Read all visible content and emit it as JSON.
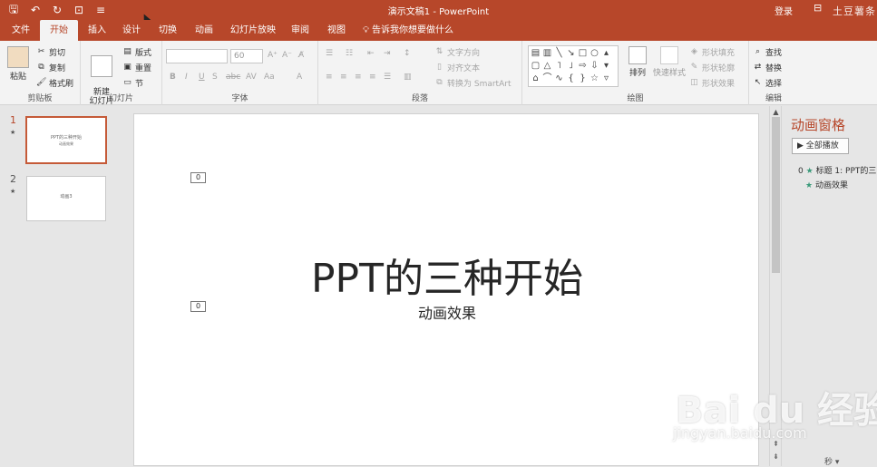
{
  "window": {
    "title": "演示文稿1  -  PowerPoint",
    "login": "登录",
    "watermark_stamp": "土豆薯条"
  },
  "qat": {
    "icons": [
      "save-icon",
      "undo-icon",
      "redo-icon",
      "start-show-icon",
      "customize-icon"
    ],
    "glyphs": [
      "🖫",
      "↶",
      "↻",
      "⊡",
      "≡"
    ]
  },
  "tabs": [
    "文件",
    "开始",
    "插入",
    "设计",
    "切换",
    "动画",
    "幻灯片放映",
    "审阅",
    "视图",
    "告诉我你想要做什么"
  ],
  "ribbon": {
    "clipboard": {
      "label": "剪贴板",
      "paste": "粘贴",
      "cut": "剪切",
      "copy": "复制",
      "format_painter": "格式刷"
    },
    "slides": {
      "label": "幻灯片",
      "new_slide": "新建\n幻灯片",
      "layout": "版式",
      "reset": "重置",
      "section": "节"
    },
    "font": {
      "label": "字体",
      "font_name": "",
      "font_size": "60"
    },
    "paragraph": {
      "label": "段落",
      "text_direction": "文字方向",
      "align_text": "对齐文本",
      "smartart": "转换为 SmartArt"
    },
    "drawing": {
      "label": "绘图",
      "arrange": "排列",
      "quick_styles": "快速样式",
      "shape_fill": "形状填充",
      "shape_outline": "形状轮廓",
      "shape_effects": "形状效果"
    },
    "editing": {
      "label": "编辑",
      "find": "查找",
      "replace": "替换",
      "select": "选择"
    }
  },
  "slides": [
    {
      "number": "1",
      "title": "PPT的三种开始",
      "subtitle": "动画效果",
      "selected": true
    },
    {
      "number": "2",
      "title": "动画3",
      "subtitle": "",
      "selected": false
    }
  ],
  "current_slide": {
    "title": "PPT的三种开始",
    "subtitle": "动画效果",
    "anim_tag_title": "0",
    "anim_tag_subtitle": "0"
  },
  "animation_pane": {
    "title": "动画窗格",
    "play_all": "全部播放",
    "items": [
      {
        "index": "0",
        "label": "标题 1: PPT的三"
      },
      {
        "index": "",
        "label": "动画效果"
      }
    ],
    "seconds": "秒 ▾"
  },
  "watermark": {
    "brand": "Bai du 经验",
    "url": "jingyan.baidu.com"
  },
  "colors": {
    "accent": "#b7472a"
  }
}
